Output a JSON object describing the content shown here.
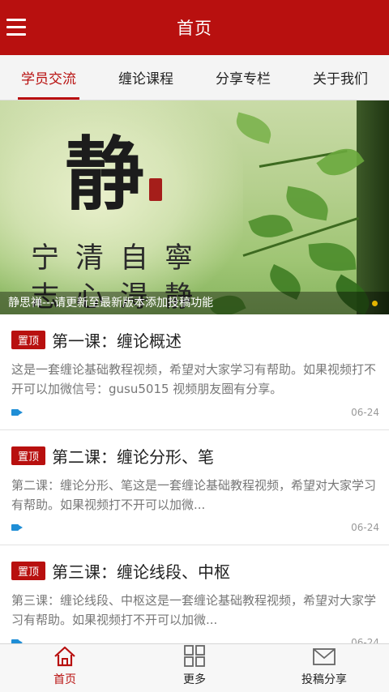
{
  "header": {
    "title": "首页",
    "menu_icon": "menu-icon"
  },
  "tabs": [
    {
      "label": "学员交流",
      "active": true
    },
    {
      "label": "缠论课程",
      "active": false
    },
    {
      "label": "分享专栏",
      "active": false
    },
    {
      "label": "关于我们",
      "active": false
    }
  ],
  "banner": {
    "big_char": "静",
    "poem_line1": "宁清自寧",
    "poem_line2": "志心淂静",
    "caption": "静思禅---请更新至最新版本添加投稿功能"
  },
  "posts": [
    {
      "tag": "置顶",
      "title": "第一课：缠论概述",
      "desc": "这是一套缠论基础教程视频，希望对大家学习有帮助。如果视频打不开可以加微信号：gusu5015 视频朋友圈有分享。",
      "date": "06-24",
      "icon": "video-icon"
    },
    {
      "tag": "置顶",
      "title": "第二课：缠论分形、笔",
      "desc": "第二课：缠论分形、笔这是一套缠论基础教程视频，希望对大家学习有帮助。如果视频打不开可以加微...",
      "date": "06-24",
      "icon": "video-icon"
    },
    {
      "tag": "置顶",
      "title": "第三课：缠论线段、中枢",
      "desc": "第三课：缠论线段、中枢这是一套缠论基础教程视频，希望对大家学习有帮助。如果视频打不开可以加微...",
      "date": "06-24",
      "icon": "video-icon"
    }
  ],
  "bottom_nav": [
    {
      "label": "首页",
      "icon": "home-icon",
      "active": true
    },
    {
      "label": "更多",
      "icon": "grid-icon",
      "active": false
    },
    {
      "label": "投稿分享",
      "icon": "mail-icon",
      "active": false
    }
  ],
  "colors": {
    "brand": "#b8100f",
    "accent_video": "#1f8ed6",
    "carousel_dot": "#e2b300"
  }
}
